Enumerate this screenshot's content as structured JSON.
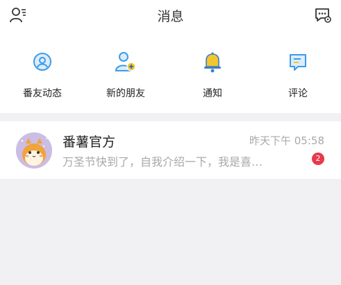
{
  "header": {
    "title": "消息",
    "left_icon": "contacts-icon",
    "right_icon": "chat-settings-icon"
  },
  "quick_actions": [
    {
      "label": "番友动态",
      "icon": "friend-feed-icon"
    },
    {
      "label": "新的朋友",
      "icon": "add-friend-icon"
    },
    {
      "label": "通知",
      "icon": "bell-icon"
    },
    {
      "label": "评论",
      "icon": "comment-icon"
    }
  ],
  "messages": [
    {
      "name": "番薯官方",
      "time": "昨天下午 05:58",
      "preview": "万圣节快到了，自我介绍一下，我是喜…",
      "unread": "2"
    }
  ],
  "colors": {
    "accent_blue": "#3b9be8",
    "bell_yellow": "#f2c62f",
    "badge_red": "#e8394c",
    "background": "#f1f1f4"
  }
}
